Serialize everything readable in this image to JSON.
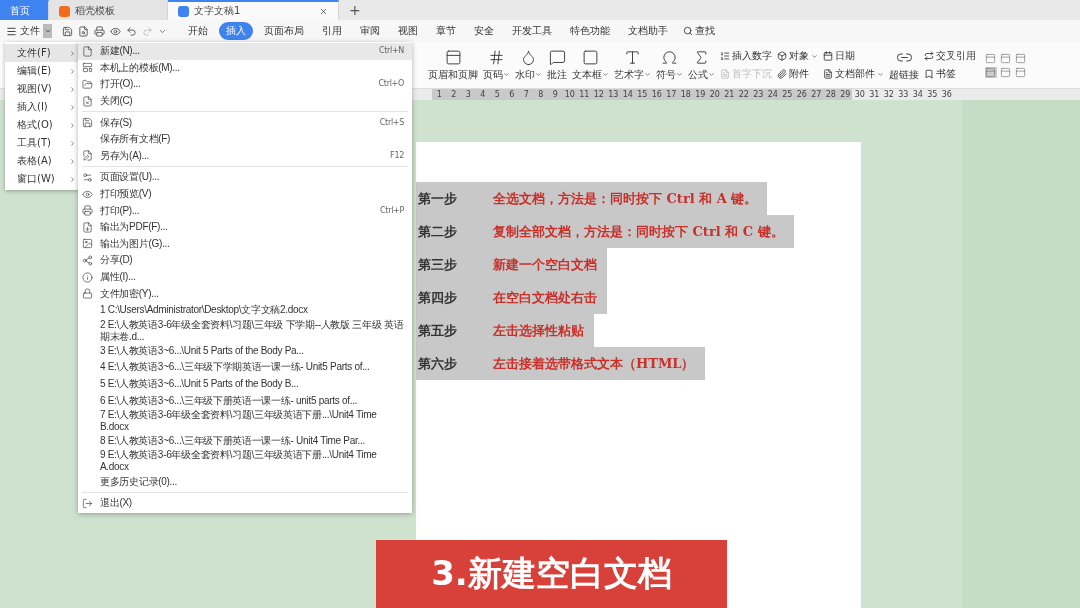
{
  "tabs": [
    {
      "label": "首页",
      "kind": "home",
      "selected": false
    },
    {
      "label": "稻壳模板",
      "kind": "template",
      "selected": false
    },
    {
      "label": "文字文稿1",
      "kind": "doc",
      "selected": true
    }
  ],
  "new_tab": "+",
  "menu_bar": {
    "file_label": "文件",
    "search": "查找",
    "tabs": [
      {
        "label": "开始",
        "selected": false
      },
      {
        "label": "插入",
        "selected": true
      },
      {
        "label": "页面布局",
        "selected": false
      },
      {
        "label": "引用",
        "selected": false
      },
      {
        "label": "审阅",
        "selected": false
      },
      {
        "label": "视图",
        "selected": false
      },
      {
        "label": "章节",
        "selected": false
      },
      {
        "label": "安全",
        "selected": false
      },
      {
        "label": "开发工具",
        "selected": false
      },
      {
        "label": "特色功能",
        "selected": false
      },
      {
        "label": "文档助手",
        "selected": false
      }
    ]
  },
  "ribbon": {
    "groups": [
      {
        "kind": "big",
        "label": "页眉和页脚",
        "has_menu": false
      },
      {
        "kind": "big",
        "label": "页码",
        "has_menu": true
      },
      {
        "kind": "big",
        "label": "水印",
        "has_menu": true
      },
      {
        "kind": "big",
        "label": "批注",
        "has_menu": false
      },
      {
        "kind": "big",
        "label": "文本框",
        "has_menu": true
      },
      {
        "kind": "big",
        "label": "艺术字",
        "has_menu": true
      },
      {
        "kind": "big",
        "label": "符号",
        "has_menu": true
      },
      {
        "kind": "big",
        "label": "公式",
        "has_menu": true
      },
      {
        "kind": "stack",
        "items": [
          {
            "label": "插入数字",
            "has_menu": false,
            "disabled": false
          },
          {
            "label": "首字下沉",
            "has_menu": false,
            "disabled": true
          }
        ]
      },
      {
        "kind": "stack",
        "items": [
          {
            "label": "对象",
            "has_menu": true,
            "disabled": false
          },
          {
            "label": "附件",
            "has_menu": false,
            "disabled": false
          }
        ]
      },
      {
        "kind": "stack",
        "items": [
          {
            "label": "日期",
            "has_menu": false,
            "disabled": false
          },
          {
            "label": "文档部件",
            "has_menu": true,
            "disabled": false
          }
        ]
      },
      {
        "kind": "big",
        "label": "超链接",
        "has_menu": false
      },
      {
        "kind": "stack",
        "items": [
          {
            "label": "交叉引用",
            "has_menu": false,
            "disabled": false
          },
          {
            "label": "书签",
            "has_menu": false,
            "disabled": false
          }
        ]
      },
      {
        "kind": "views"
      }
    ]
  },
  "ruler": {
    "labels": [
      "1",
      "2",
      "3",
      "4",
      "5",
      "6",
      "7",
      "8",
      "9",
      "10",
      "11",
      "12",
      "13",
      "14",
      "15",
      "16",
      "17",
      "18",
      "19",
      "20",
      "21",
      "22",
      "23",
      "24",
      "25",
      "26",
      "27",
      "28",
      "29",
      "30",
      "31",
      "32",
      "33",
      "34",
      "35",
      "36"
    ]
  },
  "classic_menu": {
    "items": [
      {
        "label": "文件(F)",
        "selected": true
      },
      {
        "label": "编辑(E)",
        "selected": false
      },
      {
        "label": "视图(V)",
        "selected": false
      },
      {
        "label": "插入(I)",
        "selected": false
      },
      {
        "label": "格式(O)",
        "selected": false
      },
      {
        "label": "工具(T)",
        "selected": false
      },
      {
        "label": "表格(A)",
        "selected": false
      },
      {
        "label": "窗口(W)",
        "selected": false
      }
    ]
  },
  "file_menu": {
    "sections": [
      [
        {
          "kind": "command",
          "label": "新建(N)...",
          "shortcut": "Ctrl+N",
          "selected": true
        },
        {
          "kind": "command",
          "label": "本机上的模板(M)...",
          "selected": false
        },
        {
          "kind": "command",
          "label": "打开(O)...",
          "shortcut": "Ctrl+O",
          "selected": false
        },
        {
          "kind": "command",
          "label": "关闭(C)",
          "selected": false
        }
      ],
      [
        {
          "kind": "command",
          "label": "保存(S)",
          "shortcut": "Ctrl+S",
          "selected": false
        },
        {
          "kind": "plain",
          "label": "保存所有文档(F)",
          "selected": false
        },
        {
          "kind": "command",
          "label": "另存为(A)...",
          "shortcut": "F12",
          "selected": false
        }
      ],
      [
        {
          "kind": "command",
          "label": "页面设置(U)...",
          "selected": false
        },
        {
          "kind": "command",
          "label": "打印预览(V)",
          "selected": false
        },
        {
          "kind": "command",
          "label": "打印(P)...",
          "shortcut": "Ctrl+P",
          "selected": false
        },
        {
          "kind": "command",
          "label": "输出为PDF(F)...",
          "selected": false
        },
        {
          "kind": "command",
          "label": "输出为图片(G)...",
          "selected": false
        },
        {
          "kind": "command",
          "label": "分享(D)",
          "selected": false
        },
        {
          "kind": "command",
          "label": "属性(I)...",
          "selected": false
        },
        {
          "kind": "command",
          "label": "文件加密(Y)...",
          "selected": false
        },
        {
          "kind": "recent",
          "label": "1 C:\\Users\\Administrator\\Desktop\\文字文稿2.docx",
          "selected": false
        },
        {
          "kind": "recent",
          "label": "2 E:\\人教英语3-6年级全套资料\\习题\\三年级 下学期--人教版 三年级 英语期末卷.d...",
          "selected": false
        },
        {
          "kind": "recent",
          "label": "3 E:\\人教英语3~6...\\Unit 5 Parts of the Body Pa...",
          "selected": false
        },
        {
          "kind": "recent",
          "label": "4 E:\\人教英语3~6...\\三年级下学期英语一课一练- Unit5 Parts of...",
          "selected": false
        },
        {
          "kind": "recent",
          "label": "5 E:\\人教英语3~6...\\Unit 5 Parts of the Body B...",
          "selected": false
        },
        {
          "kind": "recent",
          "label": "6 E:\\人教英语3~6...\\三年级下册英语一课一练- unit5 parts of...",
          "selected": false
        },
        {
          "kind": "recent",
          "label": "7 E:\\人教英语3-6年级全套资料\\习题\\三年级英语下册...\\Unit4 Time B.docx",
          "selected": false
        },
        {
          "kind": "recent",
          "label": "8 E:\\人教英语3~6...\\三年级下册英语一课一练- Unit4 Time Par...",
          "selected": false
        },
        {
          "kind": "recent",
          "label": "9 E:\\人教英语3-6年级全套资料\\习题\\三年级英语下册...\\Unit4 Time A.docx",
          "selected": false
        },
        {
          "kind": "recent",
          "label": "更多历史记录(0)...",
          "selected": false
        }
      ],
      [
        {
          "kind": "command",
          "label": "退出(X)",
          "selected": false
        }
      ]
    ]
  },
  "document": {
    "steps": [
      {
        "step": "第一步",
        "text": "全选文档，方法是：同时按下 Ctrl 和 A 键。",
        "selected": true
      },
      {
        "step": "第二步",
        "text": "复制全部文档，方法是：同时按下 Ctrl 和 C 键。",
        "selected": true
      },
      {
        "step": "第三步",
        "text": "新建一个空白文档",
        "selected": true
      },
      {
        "step": "第四步",
        "text": "在空白文档处右击",
        "selected": true
      },
      {
        "step": "第五步",
        "text": "左击选择性粘贴",
        "selected": true
      },
      {
        "step": "第六步",
        "text": "左击接着选带格式文本（HTML）",
        "selected": true
      }
    ]
  },
  "caption": "3.新建空白文档"
}
